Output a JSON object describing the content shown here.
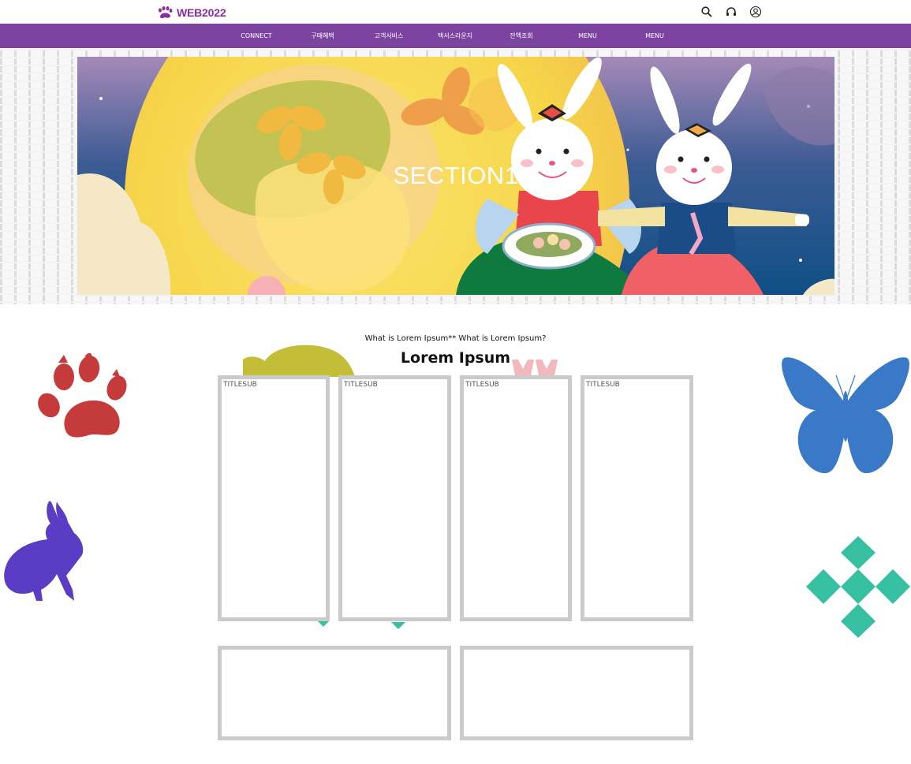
{
  "header": {
    "logo_text": "WEB2022",
    "icons": [
      "search-icon",
      "headset-icon",
      "user-icon"
    ]
  },
  "nav": {
    "items": [
      "CONNECT",
      "구매혜택",
      "고객서비스",
      "택서스라운지",
      "잔액조회",
      "MENU",
      "MENU"
    ]
  },
  "hero": {
    "title": "SECTION1"
  },
  "content": {
    "subtitle": "What is Lorem Ipsum** What is Lorem Ipsum?",
    "title": "Lorem Ipsum",
    "cards": [
      {
        "label": "TITLESUB"
      },
      {
        "label": "TITLESUB"
      },
      {
        "label": "TITLESUB"
      },
      {
        "label": "TITLESUB"
      }
    ]
  },
  "decorations": [
    "paw-icon",
    "rabbit-icon",
    "butterfly-icon",
    "diamonds-icon"
  ],
  "colors": {
    "brand": "#7c44a0",
    "logo": "#8a2da0",
    "card_border": "#cbcbcb",
    "paw": "#c53a3a",
    "rabbit": "#5b3cc4",
    "butterfly": "#3a78c8",
    "diamonds": "#36bfa0"
  }
}
